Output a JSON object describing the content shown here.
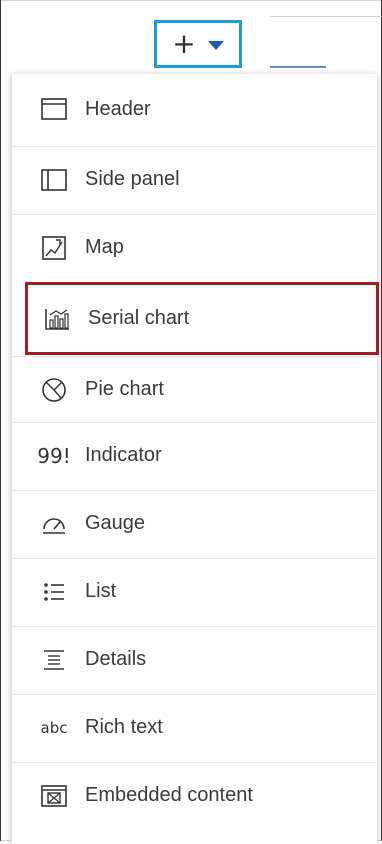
{
  "toolbar": {
    "add_symbol": "+",
    "accent_color": "#1e9ad6",
    "caret_icon": "caret-down-icon"
  },
  "menu": {
    "highlight_color": "#a51d24",
    "items": [
      {
        "label": "Header",
        "icon": "header-icon"
      },
      {
        "label": "Side panel",
        "icon": "side-panel-icon"
      },
      {
        "label": "Map",
        "icon": "map-icon"
      },
      {
        "label": "Serial chart",
        "icon": "serial-chart-icon",
        "highlighted": true
      },
      {
        "label": "Pie chart",
        "icon": "pie-chart-icon"
      },
      {
        "label": "Indicator",
        "icon": "indicator-icon",
        "icon_text": "99!"
      },
      {
        "label": "Gauge",
        "icon": "gauge-icon"
      },
      {
        "label": "List",
        "icon": "list-icon"
      },
      {
        "label": "Details",
        "icon": "details-icon"
      },
      {
        "label": "Rich text",
        "icon": "rich-text-icon",
        "icon_text": "abc"
      },
      {
        "label": "Embedded content",
        "icon": "embedded-content-icon"
      }
    ]
  }
}
